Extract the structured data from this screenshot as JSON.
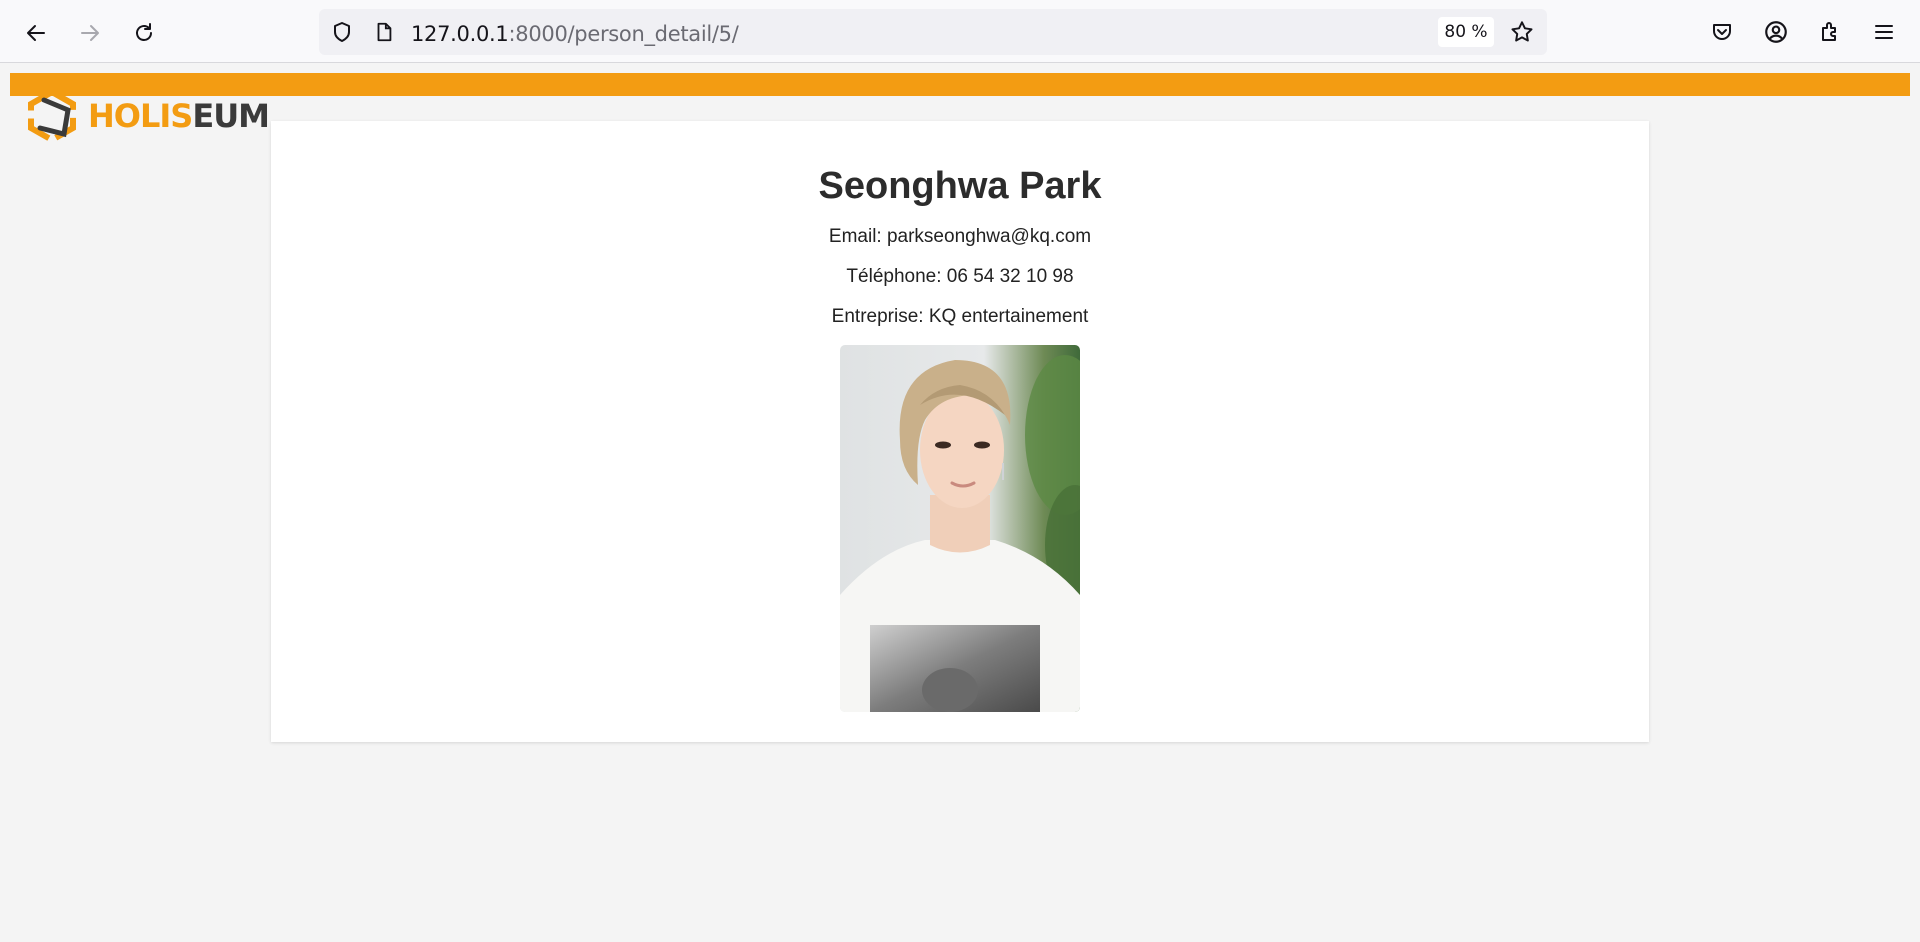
{
  "browser": {
    "url_host": "127.0.0.1",
    "url_rest": ":8000/person_detail/5/",
    "zoom": "80 %"
  },
  "brand": {
    "logo_part1": "HOLIS",
    "logo_part2": "EUM"
  },
  "person": {
    "name": "Seonghwa Park",
    "email_line": "Email: parkseonghwa@kq.com",
    "phone_line": "Téléphone: 06 54 32 10 98",
    "company_line": "Entreprise: KQ entertainement"
  },
  "colors": {
    "accent": "#f39c12",
    "text": "#2c2c2c"
  }
}
